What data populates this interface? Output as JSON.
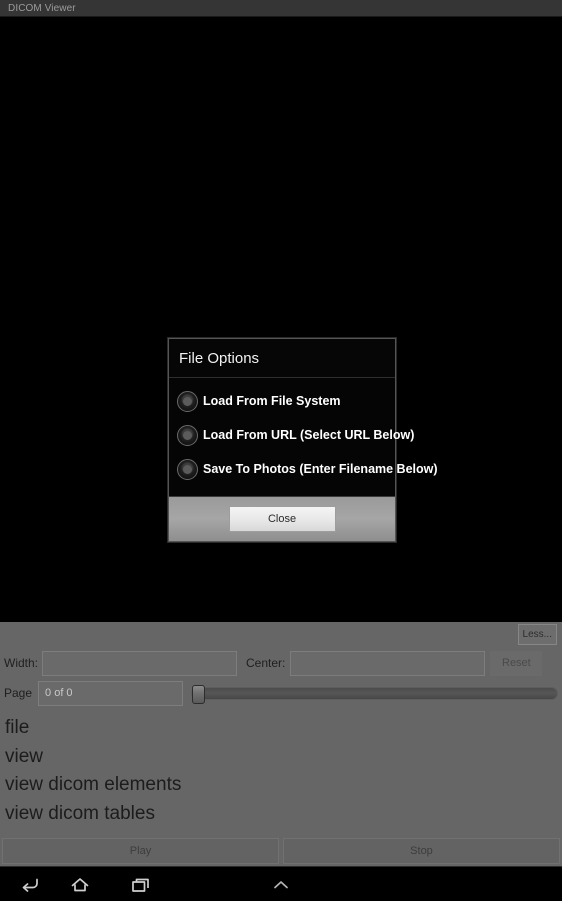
{
  "titlebar": {
    "app_title": "DICOM Viewer"
  },
  "dialog": {
    "title": "File Options",
    "options": [
      {
        "label": "Load From File System",
        "icon": "radio-unselected-icon"
      },
      {
        "label": "Load From URL (Select URL Below)",
        "icon": "radio-unselected-icon"
      },
      {
        "label": "Save To Photos (Enter Filename Below)",
        "icon": "radio-unselected-icon"
      }
    ],
    "close_label": "Close"
  },
  "controls": {
    "less_label": "Less...",
    "width_label": "Width:",
    "width_value": "",
    "center_label": "Center:",
    "center_value": "",
    "reset_label": "Reset",
    "page_label": "Page",
    "page_value": "0 of 0",
    "slider_position_percent": 0
  },
  "menu": {
    "items": [
      {
        "label": "file"
      },
      {
        "label": "view"
      },
      {
        "label": "view dicom elements"
      },
      {
        "label": "view dicom tables"
      }
    ]
  },
  "actions": {
    "play_label": "Play",
    "stop_label": "Stop"
  },
  "navbar": {
    "back_icon": "back-arrow-icon",
    "home_icon": "home-icon",
    "recents_icon": "recent-apps-icon",
    "expand_icon": "chevron-up-icon"
  },
  "colors": {
    "titlebar_bg": "#353535",
    "viewport_bg": "#000000",
    "panel_bg": "#666666",
    "dialog_bg": "#050505",
    "dialog_footer_bg": "#a0a0a0",
    "navbar_bg": "#000000"
  }
}
